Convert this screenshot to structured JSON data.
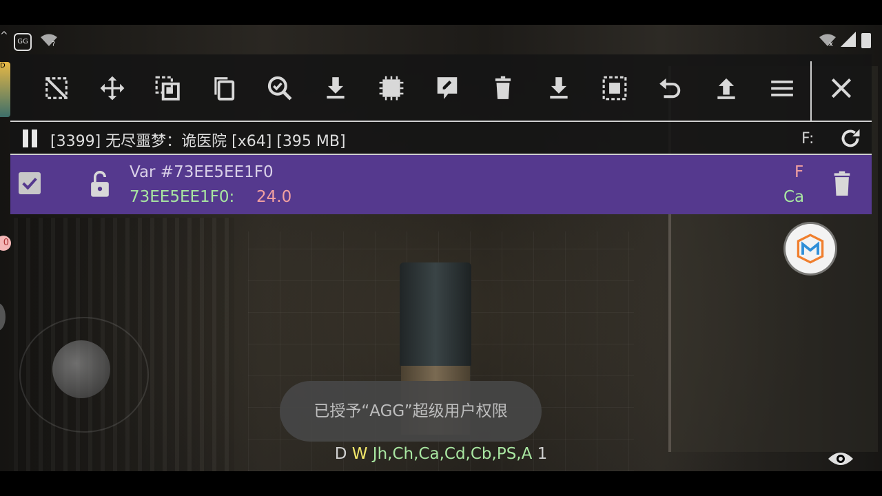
{
  "status_bar": {
    "left_icons": [
      "arrow-up-icon",
      "gg-app-icon",
      "wifi-question-icon"
    ],
    "right_icons": [
      "wifi-off-icon",
      "cell-signal-icon",
      "battery-icon"
    ]
  },
  "side": {
    "badge_text": "0",
    "thumb_text": "D"
  },
  "toolbar": {
    "icons": [
      "select-none-icon",
      "move-icon",
      "copy-selected-icon",
      "copy-icon",
      "search-check-icon",
      "download-icon",
      "memory-chip-icon",
      "edit-icon",
      "delete-icon",
      "download-alt-icon",
      "select-all-icon",
      "undo-icon",
      "upload-icon",
      "menu-icon",
      "close-icon"
    ]
  },
  "process": {
    "label": "[3399] 无尽噩梦：诡医院 [x64] [395 MB]",
    "f_label": "F:"
  },
  "entry": {
    "name": "Var #73EE5EE1F0",
    "address": "73EE5EE1F0:",
    "value": "24.0",
    "type": "F",
    "region": "Ca",
    "checked": true
  },
  "toast": {
    "text": "已授予“AGG”超级用户权限"
  },
  "legend": {
    "d": "D",
    "w": "W",
    "regions": "Jh,Ch,Ca,Cd,Cb,PS,A",
    "count": "1"
  },
  "colors": {
    "panel_bg": "#141414",
    "entry_bg": "#55398e",
    "value_red": "#f2a0a0",
    "region_green": "#a8e6a1",
    "writable_yellow": "#f3e86a"
  }
}
